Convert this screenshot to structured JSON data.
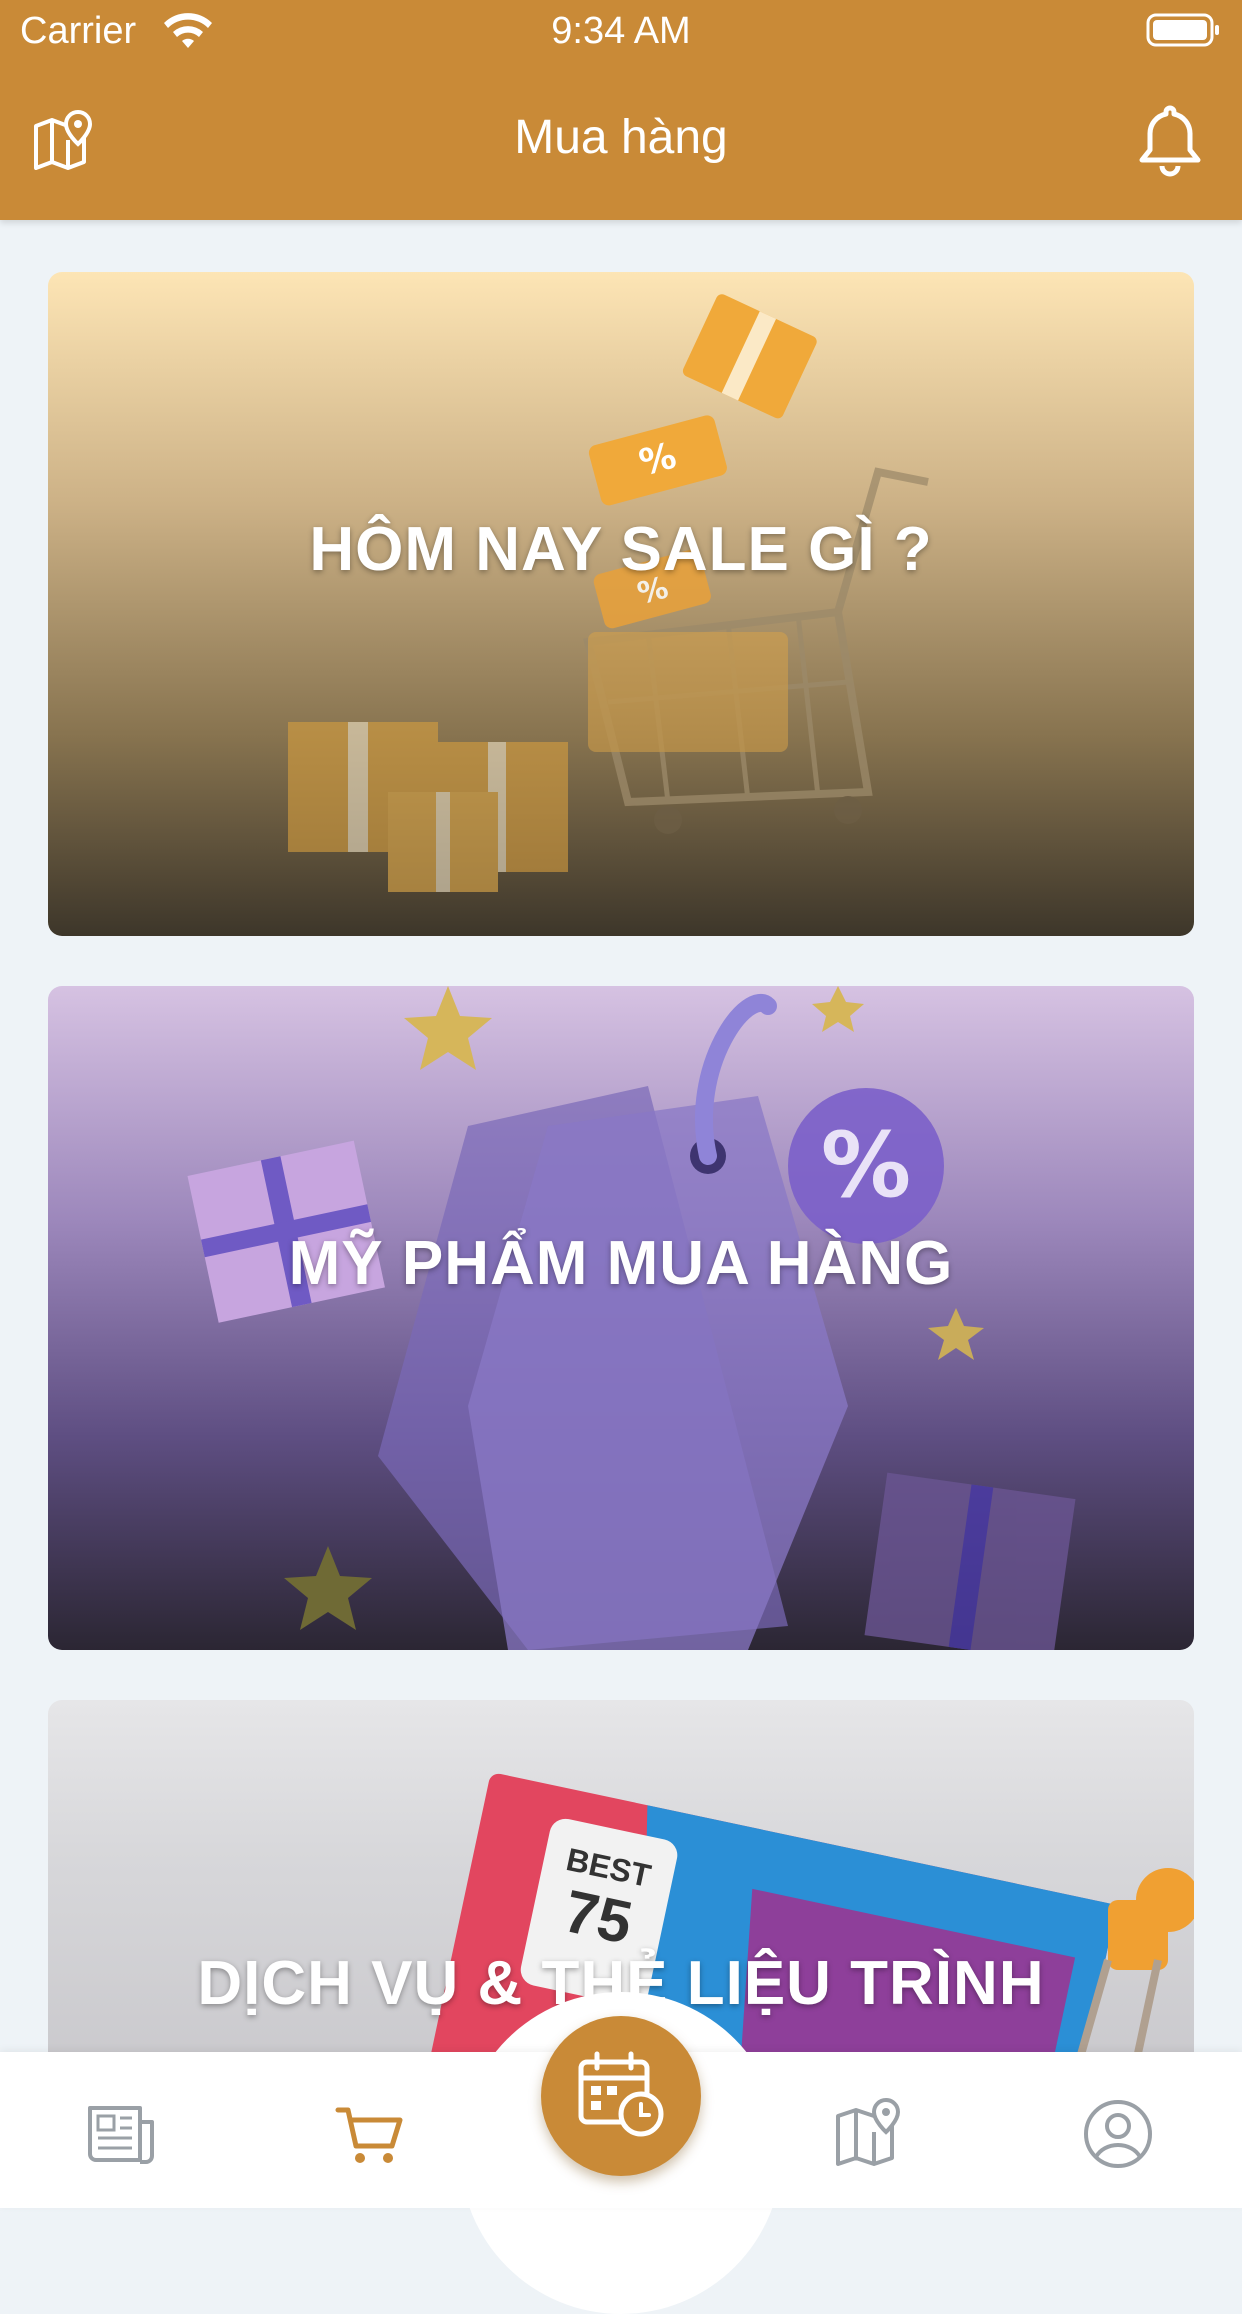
{
  "status_bar": {
    "carrier": "Carrier",
    "time": "9:34 AM"
  },
  "header": {
    "title": "Mua hàng",
    "left_icon": "map-pin-icon",
    "right_icon": "bell-icon"
  },
  "cards": [
    {
      "title": "HÔM NAY SALE GÌ ?",
      "theme_color": "#c9a35c"
    },
    {
      "title": "MỸ PHẨM MUA HÀNG",
      "theme_color": "#8a74b3"
    },
    {
      "title": "DỊCH VỤ & THẺ LIỆU TRÌNH",
      "theme_color": "#d8d8da"
    }
  ],
  "tabbar": {
    "items": [
      {
        "icon": "news-icon",
        "active": false
      },
      {
        "icon": "cart-icon",
        "active": true
      },
      {
        "icon": "calendar-clock-icon",
        "center": true
      },
      {
        "icon": "map-icon",
        "active": false
      },
      {
        "icon": "profile-icon",
        "active": false
      }
    ],
    "active_color": "#c98a37",
    "inactive_color": "#9aa0a6"
  },
  "colors": {
    "brand": "#c98a37",
    "background": "#eef3f7"
  }
}
